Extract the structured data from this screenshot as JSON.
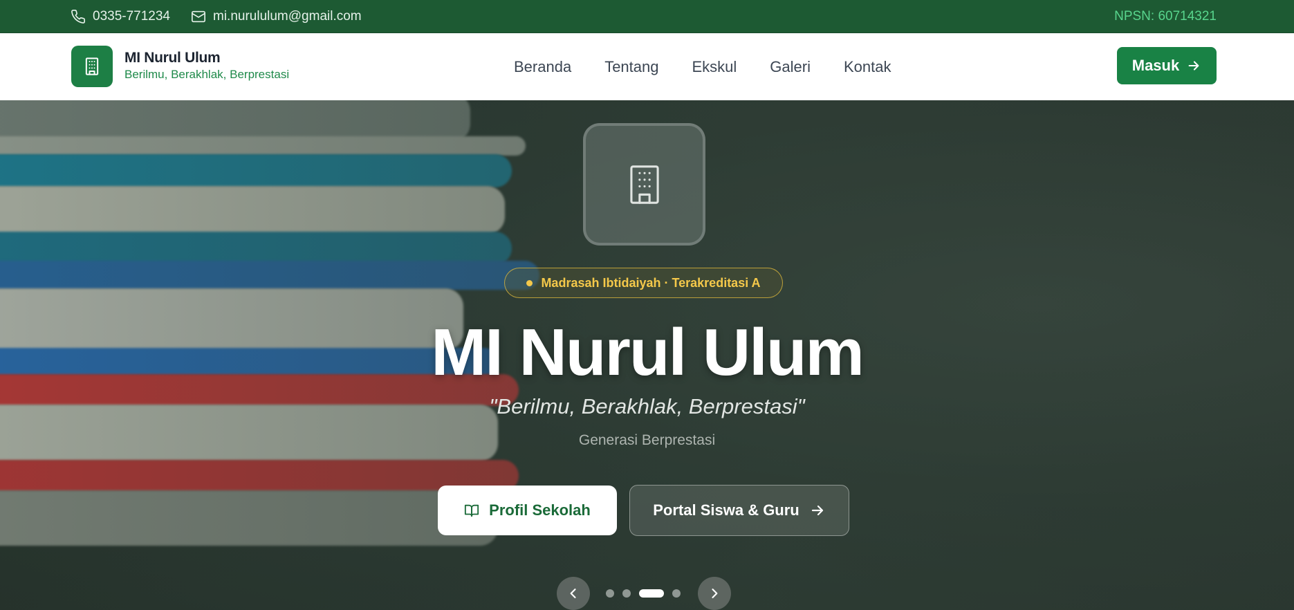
{
  "topbar": {
    "phone": "0335-771234",
    "email": "mi.nurululum@gmail.com",
    "npsn": "NPSN: 60714321"
  },
  "header": {
    "brand_name": "MI Nurul Ulum",
    "brand_tagline": "Berilmu, Berakhlak, Berprestasi",
    "nav": [
      "Beranda",
      "Tentang",
      "Ekskul",
      "Galeri",
      "Kontak"
    ],
    "login_label": "Masuk"
  },
  "hero": {
    "badge": "Madrasah Ibtidaiyah · Terakreditasi A",
    "title": "MI Nurul Ulum",
    "motto": "\"Berilmu, Berakhlak, Berprestasi\"",
    "subtitle": "Generasi Berprestasi",
    "primary_button": "Profil Sekolah",
    "secondary_button": "Portal Siswa & Guru",
    "carousel": {
      "total_slides": 4,
      "active_slide": 3
    }
  },
  "colors": {
    "topbar_bg": "#1d5a33",
    "accent_green": "#198245",
    "npsn_text": "#58d58d",
    "badge_gold": "#f4c84a"
  },
  "icons": {
    "phone": "phone-icon",
    "email": "mail-icon",
    "logo": "building-icon",
    "arrow": "arrow-right-icon",
    "book": "book-open-icon",
    "prev": "chevron-left-icon",
    "next": "chevron-right-icon"
  }
}
